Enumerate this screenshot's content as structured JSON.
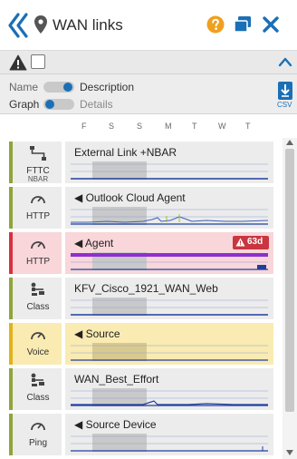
{
  "header": {
    "title": "WAN links",
    "icons": {
      "back": "double-chevron-left-icon",
      "pin": "location-pin-icon",
      "help": "help-icon",
      "windows": "windows-icon",
      "close": "close-icon"
    }
  },
  "options": {
    "row1": {
      "left": "Name",
      "right": "Description",
      "toggle": "right"
    },
    "row2": {
      "left": "Graph",
      "right": "Details",
      "toggle": "left"
    },
    "csv_label": "CSV"
  },
  "days": [
    "F",
    "S",
    "S",
    "M",
    "T",
    "W",
    "T"
  ],
  "rows": [
    {
      "type_label": "FTTC",
      "type_sub": "NBAR",
      "icon": "network-icon",
      "name": "External Link +NBAR",
      "status": "normal",
      "caret": false
    },
    {
      "type_label": "HTTP",
      "type_sub": "",
      "icon": "gauge-icon",
      "name": "Outlook Cloud Agent",
      "status": "normal",
      "caret": true
    },
    {
      "type_label": "HTTP",
      "type_sub": "",
      "icon": "gauge-icon",
      "name": "Agent",
      "status": "alert",
      "caret": true,
      "badge": "63d"
    },
    {
      "type_label": "Class",
      "type_sub": "",
      "icon": "class-icon",
      "name": "KFV_Cisco_1921_WAN_Web",
      "status": "normal",
      "caret": false
    },
    {
      "type_label": "Voice",
      "type_sub": "",
      "icon": "gauge-icon",
      "name": "Source",
      "status": "voice",
      "caret": true
    },
    {
      "type_label": "Class",
      "type_sub": "",
      "icon": "class-icon",
      "name": "WAN_Best_Effort",
      "status": "normal",
      "caret": false
    },
    {
      "type_label": "Ping",
      "type_sub": "",
      "icon": "gauge-icon",
      "name": "Source Device",
      "status": "normal",
      "caret": true
    }
  ],
  "colors": {
    "accent_blue": "#1b6fb5",
    "help_orange": "#f0a01e",
    "status_green": "#8fa43a",
    "alert_red": "#c9363f",
    "voice_yellow": "#e3b21a"
  }
}
